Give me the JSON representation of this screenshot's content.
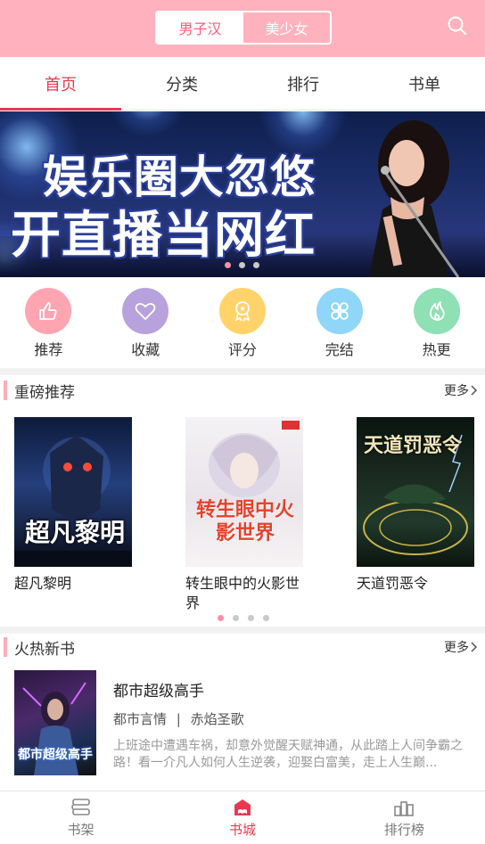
{
  "header": {
    "segment": [
      {
        "label": "男子汉",
        "active": true
      },
      {
        "label": "美少女",
        "active": false
      }
    ],
    "search_icon": "search-icon",
    "bg_color": "#ffb2bd"
  },
  "tabs": [
    {
      "label": "首页",
      "active": true
    },
    {
      "label": "分类",
      "active": false
    },
    {
      "label": "排行",
      "active": false
    },
    {
      "label": "书单",
      "active": false
    }
  ],
  "banner": {
    "line1": "娱乐圈大忽悠",
    "line2": "开直播当网红",
    "page_count": 3,
    "active_page": 1
  },
  "quick_entries": [
    {
      "label": "推荐",
      "icon": "thumbs-up-icon",
      "color": "#ffa5b2"
    },
    {
      "label": "收藏",
      "icon": "heart-icon",
      "color": "#b7a2dd"
    },
    {
      "label": "评分",
      "icon": "badge-icon",
      "color": "#ffd36a"
    },
    {
      "label": "完结",
      "icon": "clover-icon",
      "color": "#8fd6f8"
    },
    {
      "label": "热更",
      "icon": "flame-icon",
      "color": "#8fe0b4"
    }
  ],
  "featured": {
    "title": "重磅推荐",
    "more": "更多",
    "books": [
      {
        "name": "超凡黎明",
        "cover_text": "超凡黎明"
      },
      {
        "name": "转生眼中的火影世界",
        "cover_text": "转生眼中火影世界"
      },
      {
        "name": "天道罚恶令",
        "cover_text": "天道罚恶令"
      }
    ],
    "page_count": 4,
    "active_page": 1
  },
  "hot_new": {
    "title": "火热新书",
    "more": "更多",
    "items": [
      {
        "name": "都市超级高手",
        "category": "都市言情",
        "separator": "|",
        "author": "赤焰圣歌",
        "desc": "上班途中遭遇车祸，却意外觉醒天赋神通，从此踏上人间争霸之路！看一介凡人如何人生逆袭，迎娶白富美，走上人生巅...",
        "cover_text": "都市超级高手"
      }
    ]
  },
  "bottom_nav": [
    {
      "label": "书架",
      "icon": "bookshelf-icon",
      "active": false
    },
    {
      "label": "书城",
      "icon": "bookstore-icon",
      "active": true
    },
    {
      "label": "排行榜",
      "icon": "ranking-icon",
      "active": false
    }
  ]
}
